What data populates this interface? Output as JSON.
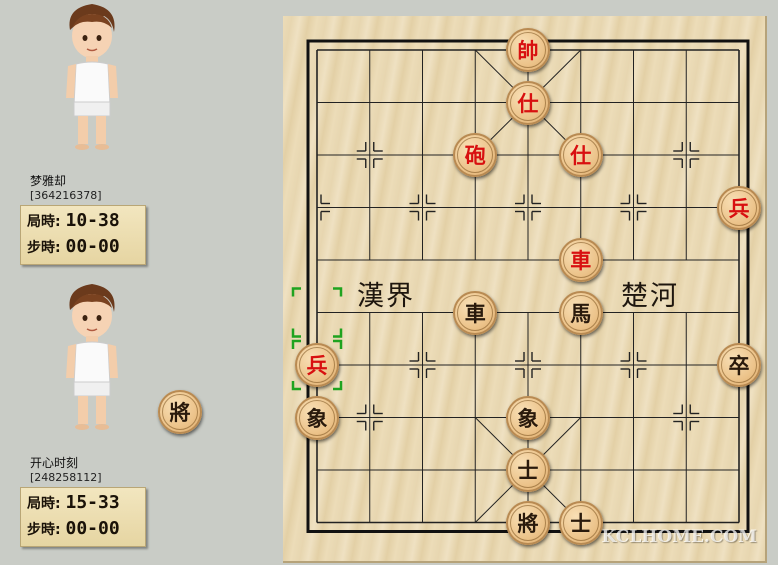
{
  "players": [
    {
      "name": "梦雅却",
      "id": "[364216378]",
      "time_label": "局時:",
      "time_value": "10-38",
      "step_label": "步時:",
      "step_value": "00-00"
    },
    {
      "name": "开心时刻",
      "id": "[248258112]",
      "time_label": "局時:",
      "time_value": "15-33",
      "step_label": "步時:",
      "step_value": "00-00"
    }
  ],
  "side_piece": {
    "char": "將",
    "color": "black"
  },
  "river": {
    "left": "漢界",
    "right": "楚河"
  },
  "pieces": [
    {
      "char": "帥",
      "color": "red",
      "col": 4,
      "row": 0
    },
    {
      "char": "仕",
      "color": "red",
      "col": 4,
      "row": 1
    },
    {
      "char": "砲",
      "color": "red",
      "col": 3,
      "row": 2
    },
    {
      "char": "仕",
      "color": "red",
      "col": 5,
      "row": 2
    },
    {
      "char": "兵",
      "color": "red",
      "col": 8,
      "row": 3
    },
    {
      "char": "車",
      "color": "red",
      "col": 5,
      "row": 4
    },
    {
      "char": "車",
      "color": "black",
      "col": 3,
      "row": 5
    },
    {
      "char": "馬",
      "color": "black",
      "col": 5,
      "row": 5
    },
    {
      "char": "兵",
      "color": "red",
      "col": 0,
      "row": 6
    },
    {
      "char": "卒",
      "color": "black",
      "col": 8,
      "row": 6
    },
    {
      "char": "象",
      "color": "black",
      "col": 0,
      "row": 7
    },
    {
      "char": "象",
      "color": "black",
      "col": 4,
      "row": 7
    },
    {
      "char": "士",
      "color": "black",
      "col": 4,
      "row": 8
    },
    {
      "char": "將",
      "color": "black",
      "col": 4,
      "row": 9
    },
    {
      "char": "士",
      "color": "black",
      "col": 5,
      "row": 9
    }
  ],
  "selected": {
    "col": 0,
    "row": 6
  },
  "colors": {
    "red_piece": "#d81010",
    "black_piece": "#2a1a0c",
    "selection": "#1fa31f"
  },
  "watermark": "KCLHOME.COM"
}
